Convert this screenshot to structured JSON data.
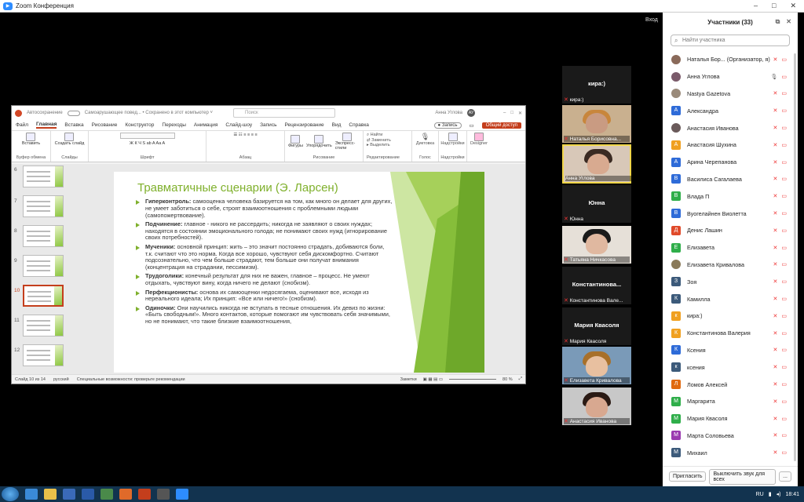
{
  "window": {
    "title": "Zoom Конференция",
    "exit_label": "Вход"
  },
  "ppt": {
    "autosave": "Автосохранение",
    "file_title": "Самоарушающее повед... • Сохранено в этот компьютер ˅",
    "search_placeholder": "Поиск",
    "user": "Анна Углова",
    "user_initials": "АУ",
    "menu": [
      "Файл",
      "Главная",
      "Вставка",
      "Рисование",
      "Конструктор",
      "Переходы",
      "Анимация",
      "Слайд-шоу",
      "Запись",
      "Рецензирование",
      "Вид",
      "Справка"
    ],
    "record": "Запись",
    "share": "Общий доступ",
    "ribbon_groups": [
      "Буфер обмена",
      "Слайды",
      "Шрифт",
      "Абзац",
      "Рисование",
      "Редактирование",
      "Голос",
      "Надстройки"
    ],
    "ribbon": {
      "paste": "Вставить",
      "new_slide": "Создать слайд",
      "shapes": "Фигуры",
      "arrange": "Упорядочить",
      "styles": "Экспресс-стили",
      "find": "Найти",
      "replace": "Заменить",
      "select": "Выделить",
      "dictate": "Диктовка",
      "addins": "Надстройки",
      "designer": "Designer"
    },
    "thumb_numbers": [
      "6",
      "7",
      "8",
      "9",
      "10",
      "11",
      "12"
    ],
    "slide": {
      "title": "Травматичные сценарии (Э. Ларсен)",
      "bullets": [
        {
          "lead": "Гиперконтроль:",
          "text": " самооценка человека базируется на том, как много он делает для других, не умеет заботиться о себе, строят взаимоотношения с проблемными людьми (самопожертвование)."
        },
        {
          "lead": "Подчинение:",
          "text": " главное - никого не рассердить; никогда не заявляют о своих нуждах; находятся в состоянии эмоционального голода; не понимают своих нужд (игнорирование своих потребностей)."
        },
        {
          "lead": "Мученики:",
          "text": " основной принцип: жить – это значит постоянно страдать, добиваются боли, т.к. считают что это норма. Когда все хорошо, чувствуют себя дискомфортно. Считают подсознательно, что чем больше страдают, тем больше они получат внимания (концентрация на страдании, пессимизм)."
        },
        {
          "lead": "Трудоголики:",
          "text": " конечный результат для них не важен, главное – процесс. Не умеют отдыхать, чувствуют вину, когда ничего не делают (снобизм)."
        },
        {
          "lead": "Перфекционисты:",
          "text": " основа их самооценки недосягаема, оценивают все, исходя из нереального идеала; Их принцип: «Все или ничего!» (снобизм)."
        },
        {
          "lead": "Одиночки:",
          "text": " Они научились никогда не вступать в тесные отношения. Их девиз по жизни: «Быть свободным!». Много контактов, которые помогают им чувствовать себя значимыми, но не понимают, что такие близкие взаимоотношения,"
        }
      ]
    },
    "status": {
      "slide": "Слайд 10 из 14",
      "lang": "русский",
      "access": "Специальные возможности: проверьте рекомендации",
      "notes": "Заметки",
      "zoom": "80 %"
    }
  },
  "video_tiles": [
    {
      "big": "кира:)",
      "name": "кира:)",
      "type": "name"
    },
    {
      "name": "Наталья Борисовна...",
      "type": "video"
    },
    {
      "name": "Анна Углова",
      "type": "video"
    },
    {
      "big": "Юнна",
      "name": "Юнна",
      "type": "name"
    },
    {
      "name": "Татьяна Ничкасова",
      "type": "video"
    },
    {
      "big": "Константинова...",
      "name": "Константинова Вале...",
      "type": "name"
    },
    {
      "big": "Мария Квасоля",
      "name": "Мария Квасоля",
      "type": "name"
    },
    {
      "name": "Елизавета Кривалова",
      "type": "video"
    },
    {
      "name": "Анастасия Иванова",
      "type": "video"
    }
  ],
  "panel": {
    "title": "Участники (33)",
    "search_placeholder": "Найти участника",
    "invite": "Пригласить",
    "mute_all": "Выключить звук для всех",
    "more": "...",
    "participants": [
      {
        "name": "Наталья Бор... (Организатор, я)",
        "initial": "",
        "color": "#8a6a5a",
        "photo": true
      },
      {
        "name": "Анна Углова",
        "initial": "",
        "color": "#7a5a6a",
        "photo": true
      },
      {
        "name": "Nastya Gazetova",
        "initial": "",
        "color": "#9a8a7a",
        "photo": true
      },
      {
        "name": "Александра",
        "initial": "А",
        "color": "#2e6bd8"
      },
      {
        "name": "Анастасия Иванова",
        "initial": "",
        "color": "#6a5a5a",
        "photo": true
      },
      {
        "name": "Анастасия Шухина",
        "initial": "А",
        "color": "#f0a020"
      },
      {
        "name": "Арина Черепанова",
        "initial": "А",
        "color": "#2e6bd8"
      },
      {
        "name": "Василиса Сагалаева",
        "initial": "В",
        "color": "#2e6bd8"
      },
      {
        "name": "Влада П",
        "initial": "В",
        "color": "#2fae4a"
      },
      {
        "name": "Вуогелайнен Виолетта",
        "initial": "В",
        "color": "#2e6bd8"
      },
      {
        "name": "Денис Лашин",
        "initial": "Д",
        "color": "#e04a2a"
      },
      {
        "name": "Елизавета",
        "initial": "Е",
        "color": "#2fae4a"
      },
      {
        "name": "Елизавета Кривалова",
        "initial": "",
        "color": "#8a7a5a",
        "photo": true
      },
      {
        "name": "Зоя",
        "initial": "З",
        "color": "#3c5a7a"
      },
      {
        "name": "Камилла",
        "initial": "К",
        "color": "#3c5a7a"
      },
      {
        "name": "кира:)",
        "initial": "к",
        "color": "#f0a020"
      },
      {
        "name": "Константинова Валерия",
        "initial": "К",
        "color": "#f0a020"
      },
      {
        "name": "Ксения",
        "initial": "К",
        "color": "#2e6bd8"
      },
      {
        "name": "ксения",
        "initial": "к",
        "color": "#3c5a7a"
      },
      {
        "name": "Ломов Алексей",
        "initial": "Л",
        "color": "#e06a10"
      },
      {
        "name": "Маргарита",
        "initial": "М",
        "color": "#2fae4a"
      },
      {
        "name": "Мария Квасоля",
        "initial": "М",
        "color": "#2fae4a"
      },
      {
        "name": "Марта Соловьева",
        "initial": "М",
        "color": "#9a3ab0"
      },
      {
        "name": "Михаил",
        "initial": "М",
        "color": "#3c5a7a"
      }
    ]
  },
  "taskbar": {
    "lang": "RU",
    "time": "18:41"
  }
}
